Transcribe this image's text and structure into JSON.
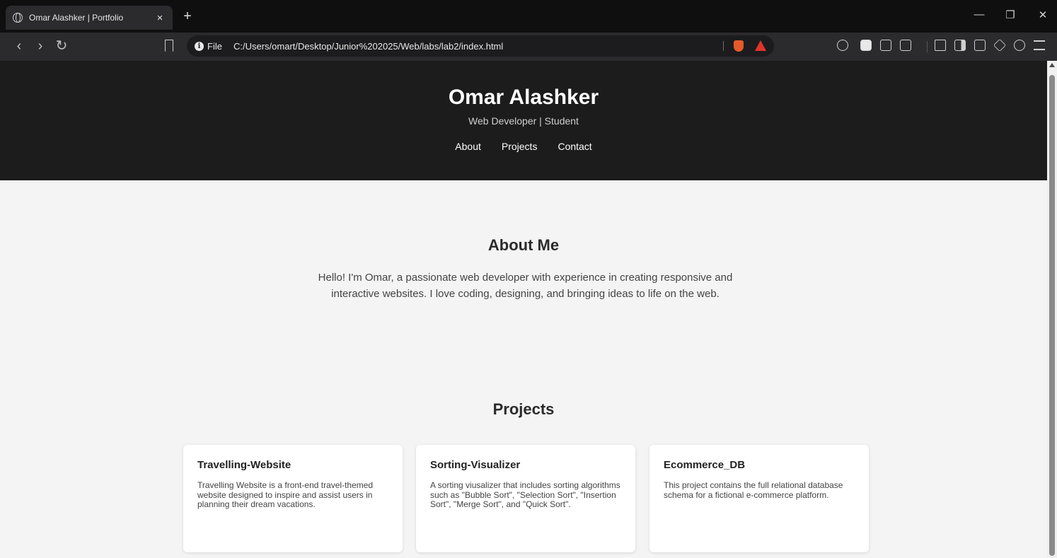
{
  "browser": {
    "tab_title": "Omar Alashker | Portfolio",
    "tab_close": "×",
    "new_tab": "+",
    "window_controls": {
      "minimize": "—",
      "restore": "❐",
      "close": "✕"
    },
    "nav": {
      "back": "‹",
      "forward": "›",
      "reload": "↻"
    },
    "address": {
      "scheme_label": "File",
      "url": "C:/Users/omart/Desktop/Junior%202025/Web/labs/lab2/index.html"
    }
  },
  "site": {
    "name": "Omar Alashker",
    "tagline": "Web Developer | Student",
    "nav": [
      "About",
      "Projects",
      "Contact"
    ]
  },
  "about": {
    "title": "About Me",
    "text": "Hello! I'm Omar, a passionate web developer with experience in creating responsive and interactive websites. I love coding, designing, and bringing ideas to life on the web."
  },
  "projects": {
    "title": "Projects",
    "items": [
      {
        "name": "Travelling-Website",
        "description": "Travelling Website is a front-end travel-themed website designed to inspire and assist users in planning their dream vacations."
      },
      {
        "name": "Sorting-Visualizer",
        "description": "A sorting viusalizer that includes sorting algorithms such as \"Bubble Sort\", \"Selection Sort\", \"Insertion Sort\", \"Merge Sort\", and \"Quick Sort\"."
      },
      {
        "name": "Ecommerce_DB",
        "description": "This project contains the full relational database schema for a fictional e-commerce platform."
      }
    ]
  },
  "colors": {
    "hero_bg": "#1c1c1c",
    "page_bg": "#f4f4f4",
    "card_bg": "#ffffff",
    "browser_bg": "#2b2b2e"
  }
}
